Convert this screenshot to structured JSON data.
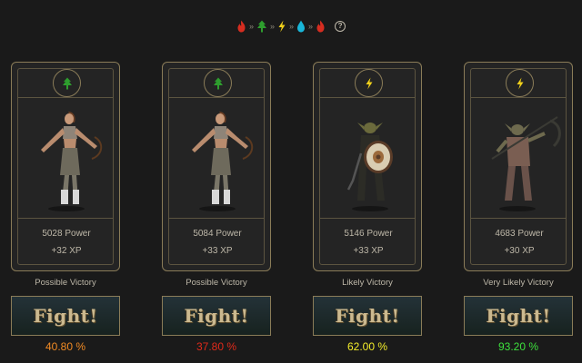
{
  "element_chain": [
    {
      "icon": "fire",
      "color": "#d62d20"
    },
    {
      "icon": "tree",
      "color": "#2e9e2e"
    },
    {
      "icon": "lightning",
      "color": "#f2d21b"
    },
    {
      "icon": "water",
      "color": "#19b6d8"
    },
    {
      "icon": "fire",
      "color": "#d62d20"
    }
  ],
  "chain_separator": "»",
  "help_label": "?",
  "fight_label": "Fight!",
  "opponents": [
    {
      "element": "tree",
      "element_color": "#2e9e2e",
      "creature": "female-archer",
      "power": "5028 Power",
      "xp": "+32 XP",
      "verdict": "Possible Victory",
      "chance": "40.80 %",
      "chance_color": "#f08a24"
    },
    {
      "element": "tree",
      "element_color": "#2e9e2e",
      "creature": "female-archer",
      "power": "5084 Power",
      "xp": "+33 XP",
      "verdict": "Possible Victory",
      "chance": "37.80 %",
      "chance_color": "#e02a1a"
    },
    {
      "element": "lightning",
      "element_color": "#f2d21b",
      "creature": "goblin-shield",
      "power": "5146 Power",
      "xp": "+33 XP",
      "verdict": "Likely Victory",
      "chance": "62.00 %",
      "chance_color": "#f2ec2a"
    },
    {
      "element": "lightning",
      "element_color": "#f2d21b",
      "creature": "goblin-scythe",
      "power": "4683 Power",
      "xp": "+30 XP",
      "verdict": "Very Likely Victory",
      "chance": "93.20 %",
      "chance_color": "#3de03d"
    }
  ]
}
